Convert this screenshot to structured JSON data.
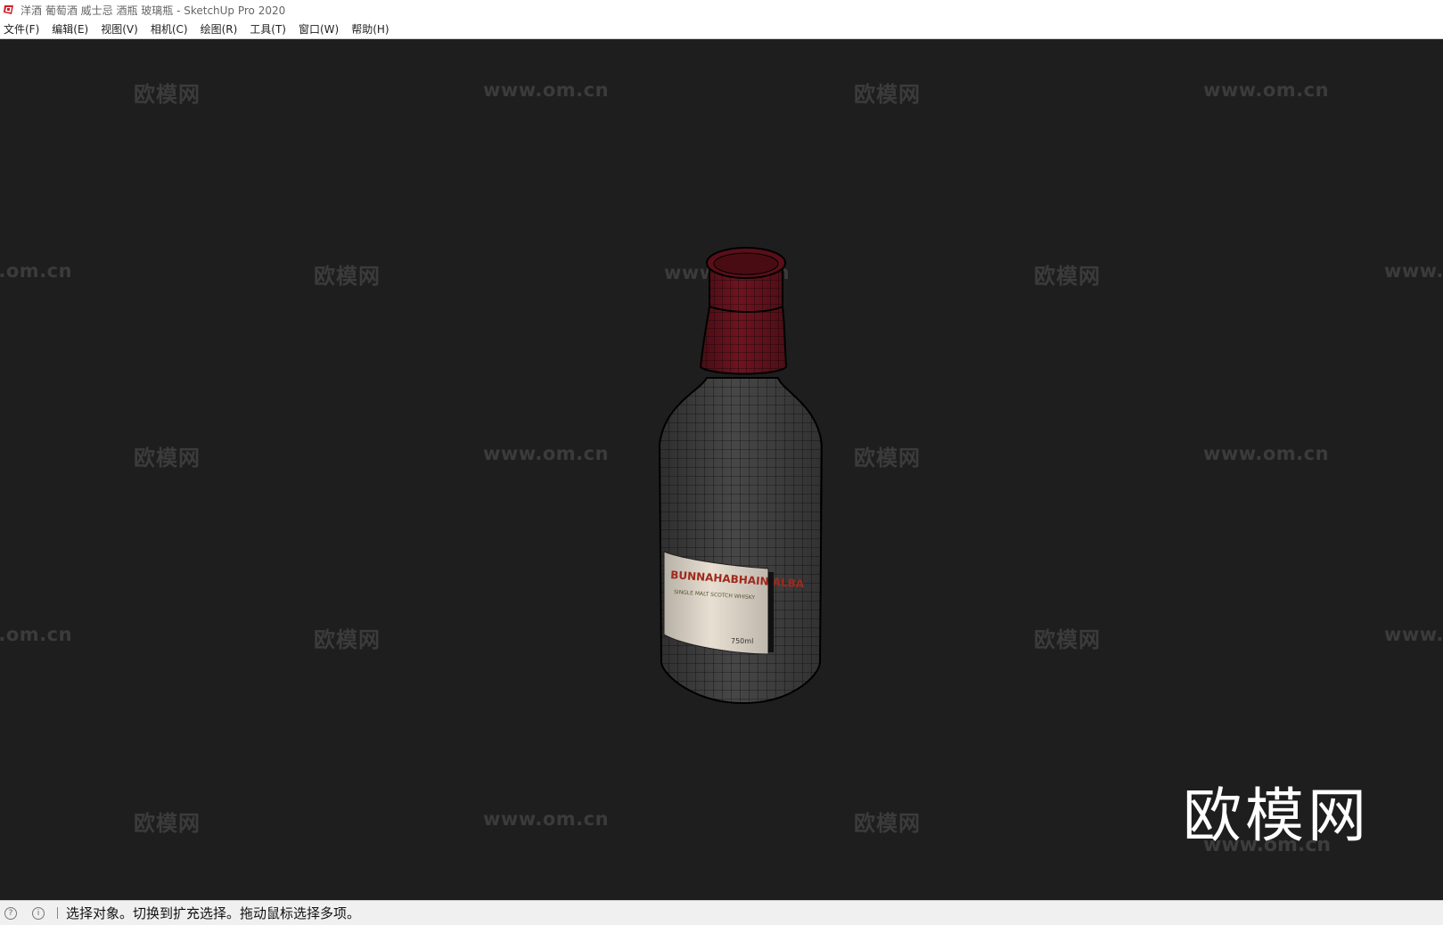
{
  "window": {
    "title": "洋酒 葡萄酒 威士忌 酒瓶 玻璃瓶 - SketchUp Pro 2020"
  },
  "menu": [
    {
      "label": "文件(F)"
    },
    {
      "label": "编辑(E)"
    },
    {
      "label": "视图(V)"
    },
    {
      "label": "相机(C)"
    },
    {
      "label": "绘图(R)"
    },
    {
      "label": "工具(T)"
    },
    {
      "label": "窗口(W)"
    },
    {
      "label": "帮助(H)"
    }
  ],
  "watermark": {
    "brand": "欧模网",
    "url": "www.om.cn"
  },
  "bottle_label": {
    "brand": "BUNNAHABHAIN ALBA",
    "subtitle": "SINGLE MALT SCOTCH WHISKY",
    "volume": "750ml"
  },
  "status": {
    "message": "选择对象。切换到扩充选择。拖动鼠标选择多项。"
  },
  "colors": {
    "viewport_bg": "#1e1e1e",
    "cap": "#6e1420",
    "glass": "#454545",
    "label": "#e8dfd2"
  }
}
